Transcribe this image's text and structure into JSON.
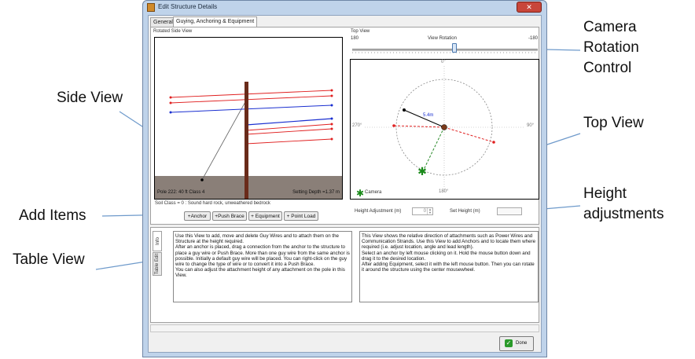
{
  "window": {
    "title": "Edit Structure Details",
    "close_label": "✕",
    "tabs": [
      "General",
      "Guying, Anchoring & Equipment"
    ]
  },
  "side_view": {
    "label": "Rotated Side View",
    "pole_info": "Pole 222: 40 ft Class 4",
    "setting_depth": "Setting Depth =1.37 m",
    "soil_class": "Soil Class = 0 : Sound hard rock, unweathered bedrock"
  },
  "add_buttons": [
    "+Anchor",
    "+Push Brace",
    "+ Equipment",
    "+ Point Load"
  ],
  "top_view": {
    "label": "Top View",
    "rotation_left": "180",
    "rotation_title": "View Rotation",
    "rotation_right": "-180",
    "rotation_level": 0.55,
    "deg_0": "0°",
    "deg_90": "90°",
    "deg_180": "180°",
    "deg_270": "270°",
    "distance_label": "5.4m",
    "camera_label": "Camera"
  },
  "height": {
    "adjust_label": "Height Adjustment (m)",
    "adjust_value": "0",
    "set_label": "Set Height (m)",
    "set_value": ""
  },
  "bottom_tabs": [
    "Info",
    "Table Edit"
  ],
  "info_left": "Use this View to add, move and delete Guy Wires and to attach them on the Structure at the height required.\nAfter an anchor is placed, drag a connection from the anchor to the structure to place a guy wire or Push Brace. More than one guy wire from the same anchor is possible. Initially a default guy wire will be placed. You can right-click on the guy wire to change the type of wire or to convert it into a Push Brace.\nYou can also adjust the attachment height of any attachment on the pole in this View.",
  "info_right": "This View shows the relative direction of attachments such as Power Wires and Communication Strands. Use this View to add Anchors and to locate them where required (i.e. adjust location, angle and lead length).\nSelect an anchor by left mouse clicking on it. Hold the mouse button down and drag it to the desired location.\nAfter adding Equipment, select it with the left mouse button. Then you can rotate it around the structure using the center mousewheel.",
  "done_label": "Done",
  "callouts": {
    "side_view": "Side View",
    "add_items": "Add Items",
    "table_view": "Table View",
    "camera_rotation": "Camera\nRotation\nControl",
    "top_view": "Top View",
    "height_adjustments": "Height\nadjustments"
  },
  "colors": {
    "red_wire": "#e02020",
    "blue_wire": "#1a2fd0",
    "pole": "#6a2b1a",
    "ground": "#8a7f78",
    "anchor_green": "#2a8a2a",
    "callout_arrow": "#6e9acb"
  }
}
